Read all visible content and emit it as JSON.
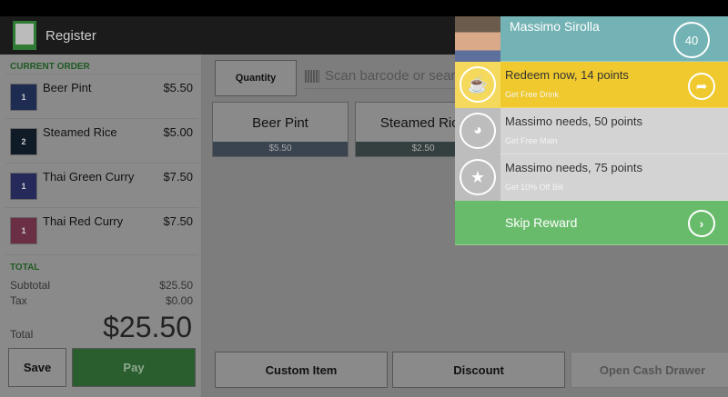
{
  "header": {
    "title": "Register"
  },
  "order": {
    "section_label": "CURRENT ORDER",
    "items": [
      {
        "qty": "1",
        "name": "Beer Pint",
        "price": "$5.50",
        "color": "#1f2c52"
      },
      {
        "qty": "2",
        "name": "Steamed Rice",
        "price": "$5.00",
        "color": "#0f1c28"
      },
      {
        "qty": "1",
        "name": "Thai Green Curry",
        "price": "$7.50",
        "color": "#262a5a"
      },
      {
        "qty": "1",
        "name": "Thai Red Curry",
        "price": "$7.50",
        "color": "#6a2e45"
      }
    ]
  },
  "totals": {
    "section_label": "TOTAL",
    "subtotal_label": "Subtotal",
    "subtotal": "$25.50",
    "tax_label": "Tax",
    "tax": "$0.00",
    "total_label": "Total",
    "total": "$25.50"
  },
  "actions": {
    "save": "Save",
    "pay": "Pay",
    "custom_item": "Custom Item",
    "discount": "Discount",
    "open_cash_drawer": "Open Cash Drawer",
    "quantity": "Quantity"
  },
  "search": {
    "placeholder": "Scan barcode or search"
  },
  "products": [
    {
      "name": "Beer Pint",
      "price": "$5.50"
    },
    {
      "name": "Steamed Rice",
      "price": "$2.50"
    }
  ],
  "loyalty": {
    "customer": "Massimo Sirolla",
    "points": "40",
    "rewards": [
      {
        "title": "Redeem now, 14 points",
        "subtitle": "Get Free Drink",
        "icon": "beer-mug-icon",
        "color": "#efc92e"
      },
      {
        "title": "Massimo needs, 50 points",
        "subtitle": "Get Free Main",
        "icon": "bowl-icon",
        "color": "#d3d3d3"
      },
      {
        "title": "Massimo needs, 75 points",
        "subtitle": "Get 10% Off Bill",
        "icon": "star-icon",
        "color": "#d3d3d3"
      }
    ],
    "skip": "Skip Reward"
  }
}
